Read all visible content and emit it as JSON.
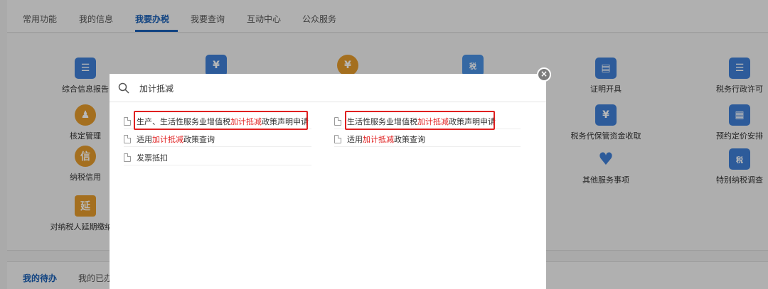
{
  "tabs": [
    {
      "label": "常用功能"
    },
    {
      "label": "我的信息"
    },
    {
      "label": "我要办税",
      "active": true
    },
    {
      "label": "我要查询"
    },
    {
      "label": "互动中心"
    },
    {
      "label": "公众服务"
    }
  ],
  "background_items": {
    "zonghe": "综合信息报告",
    "zhengming": "证明开具",
    "xingzheng": "税务行政许可",
    "heding": "核定管理",
    "daibao": "税务代保管资金收取",
    "yuyue": "预约定价安排",
    "nashui_xinyong": "纳税信用",
    "qita": "其他服务事项",
    "tebie": "特别纳税调查",
    "yanqi": "对纳税人延期缴纳税",
    "icon_text_xin": "信",
    "icon_text_yan": "延",
    "icon_text_shui": "税"
  },
  "bottom_tabs": [
    {
      "label": "我的待办",
      "active": true
    },
    {
      "label": "我的已办"
    }
  ],
  "search": {
    "value": "加计抵减"
  },
  "results_left": [
    {
      "prefix": "生产、生活性服务业增值税",
      "highlight": "加计抵减",
      "suffix": "政策声明申请"
    },
    {
      "prefix": "适用",
      "highlight": "加计抵减",
      "suffix": "政策查询"
    },
    {
      "prefix": "发票抵扣",
      "highlight": "",
      "suffix": ""
    }
  ],
  "results_right": [
    {
      "prefix": "生活性服务业增值税",
      "highlight": "加计抵减",
      "suffix": "政策声明申请"
    },
    {
      "prefix": "适用",
      "highlight": "加计抵减",
      "suffix": "政策查询"
    }
  ],
  "close_label": "×",
  "colors": {
    "accent": "#1a5fb4",
    "highlight": "#e02020",
    "icon_blue": "#3f7fd6",
    "icon_orange": "#e39a2c"
  }
}
